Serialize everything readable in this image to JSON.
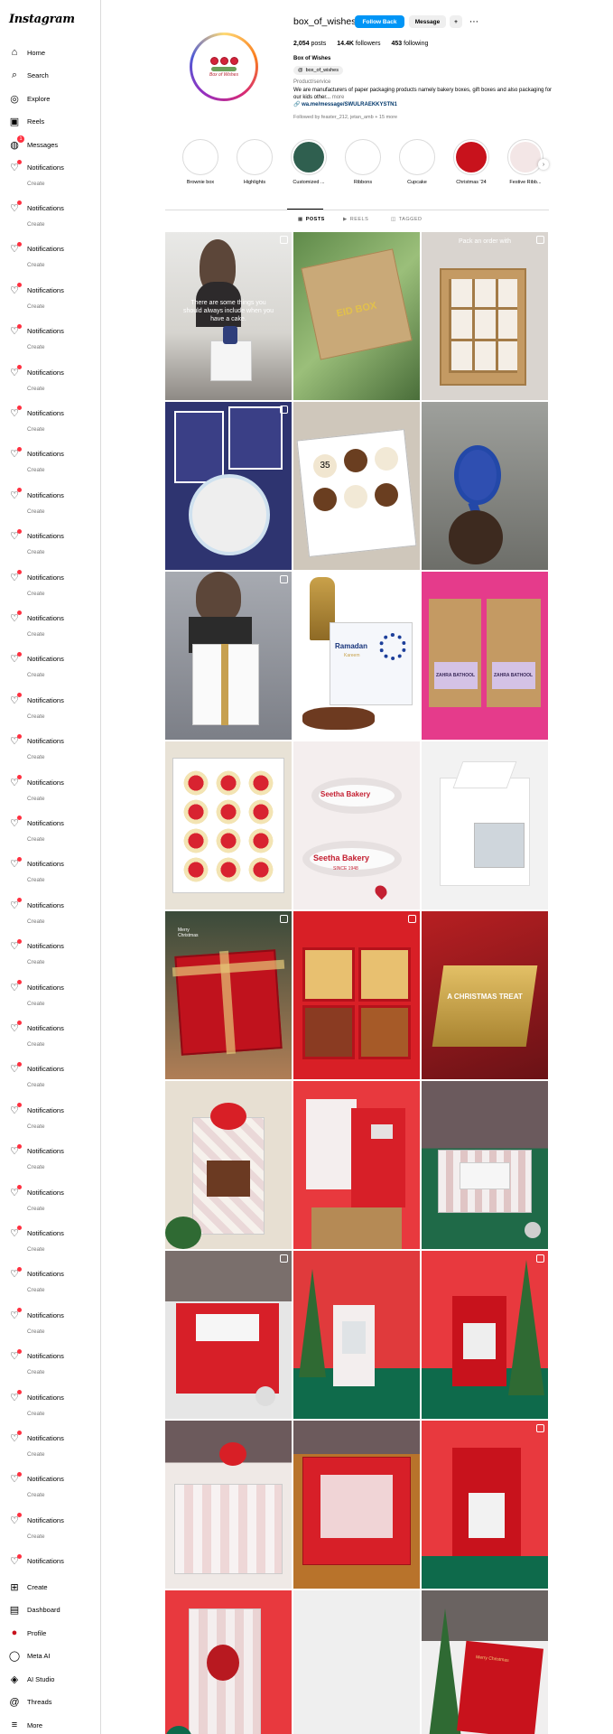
{
  "app": {
    "logo": "Instagram"
  },
  "sidebar": {
    "top_items": [
      {
        "label": "Home",
        "icon": "home-icon"
      },
      {
        "label": "Search",
        "icon": "search-icon"
      },
      {
        "label": "Explore",
        "icon": "compass-icon"
      },
      {
        "label": "Reels",
        "icon": "reels-icon"
      },
      {
        "label": "Messages",
        "icon": "messenger-icon",
        "badge": "1"
      }
    ],
    "repeated_label": "Notifications",
    "repeated_faint_label": "Create",
    "bottom_items": [
      {
        "label": "Create",
        "icon": "plus-square-icon"
      },
      {
        "label": "Dashboard",
        "icon": "dashboard-icon"
      },
      {
        "label": "Profile",
        "icon": "avatar"
      },
      {
        "label": "Meta AI",
        "icon": "meta-ai-icon"
      },
      {
        "label": "AI Studio",
        "icon": "ai-studio-icon"
      },
      {
        "label": "Threads",
        "icon": "threads-icon"
      },
      {
        "label": "More",
        "icon": "menu-icon"
      }
    ]
  },
  "profile": {
    "username": "box_of_wishes",
    "follow_back_label": "Follow Back",
    "message_label": "Message",
    "add_person_label": "+",
    "more_label": "⋯",
    "posts_count": "2,054",
    "posts_label": "posts",
    "followers_count": "14.4K",
    "followers_label": "followers",
    "following_count": "453",
    "following_label": "following",
    "full_name": "Box of Wishes",
    "threads_handle": "box_of_wishes",
    "category": "Product/service",
    "bio": "We are manufacturers of paper packaging products namely bakery boxes, gift boxes and also packaging for our kids other... ",
    "bio_more": "more",
    "link": "wa.me/message/SWULRAEKKYSTN1",
    "followed_by": "Followed by feaster_212, jetan_amb + 15 more",
    "avatar_text": "Box of Wishes"
  },
  "highlights": [
    {
      "label": "Brownie box"
    },
    {
      "label": "Highlights"
    },
    {
      "label": "Customized ..."
    },
    {
      "label": "Ribbons"
    },
    {
      "label": "Cupcake"
    },
    {
      "label": "Christmas '24"
    },
    {
      "label": "Festive Ribb..."
    }
  ],
  "tabs": [
    {
      "label": "POSTS"
    },
    {
      "label": "REELS"
    },
    {
      "label": "TAGGED"
    }
  ],
  "posts": {
    "overlay_1": "There are some things you should always include when you have a cake.",
    "overlay_2": "Pack an order with",
    "overlay_3": "A CHRISTMAS TREAT",
    "overlay_4": "Merry Christmas",
    "ribbon_1": "Seetha Bakery",
    "ribbon_2": "SINCE 1948",
    "ramadan": "Ramadan",
    "ramadan_sub": "Kareem",
    "zahra": "ZAHRA BATHOOL",
    "eid": "EID BOX",
    "cupcake_number": "35"
  },
  "colors": {
    "accent": "#0095f6",
    "badge": "#ff3040",
    "red": "#d71f28",
    "kraft": "#c49a63"
  }
}
